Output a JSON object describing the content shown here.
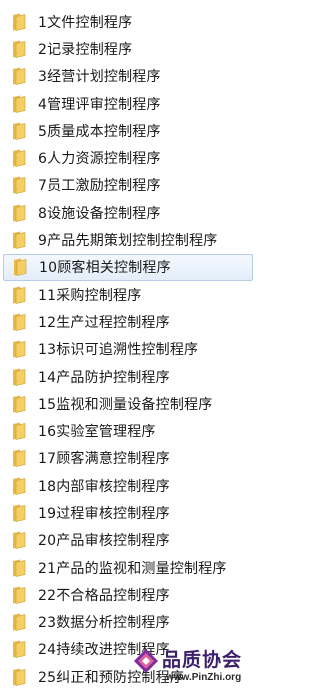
{
  "colors": {
    "folder_body": "#e8b84a",
    "folder_front": "#f5cf63",
    "selection_border": "#b4cde8",
    "watermark_text": "#3b1f6b"
  },
  "icon": "folder-icon",
  "selected_index": 9,
  "files": [
    {
      "name": "1文件控制程序"
    },
    {
      "name": "2记录控制程序"
    },
    {
      "name": "3经营计划控制程序"
    },
    {
      "name": "4管理评审控制程序"
    },
    {
      "name": "5质量成本控制程序"
    },
    {
      "name": "6人力资源控制程序"
    },
    {
      "name": "7员工激励控制程序"
    },
    {
      "name": "8设施设备控制程序"
    },
    {
      "name": "9产品先期策划控制控制程序"
    },
    {
      "name": "10顾客相关控制程序"
    },
    {
      "name": "11采购控制程序"
    },
    {
      "name": "12生产过程控制程序"
    },
    {
      "name": "13标识可追溯性控制程序"
    },
    {
      "name": "14产品防护控制程序"
    },
    {
      "name": "15监视和测量设备控制程序"
    },
    {
      "name": "16实验室管理程序"
    },
    {
      "name": "17顾客满意控制程序"
    },
    {
      "name": "18内部审核控制程序"
    },
    {
      "name": "19过程审核控制程序"
    },
    {
      "name": "20产品审核控制程序"
    },
    {
      "name": "21产品的监视和测量控制程序"
    },
    {
      "name": "22不合格品控制程序"
    },
    {
      "name": "23数据分析控制程序"
    },
    {
      "name": "24持续改进控制程序"
    },
    {
      "name": "25纠正和预防控制程序"
    }
  ],
  "watermark": {
    "title": "品质协会",
    "url": "www.PinZhi.org"
  }
}
